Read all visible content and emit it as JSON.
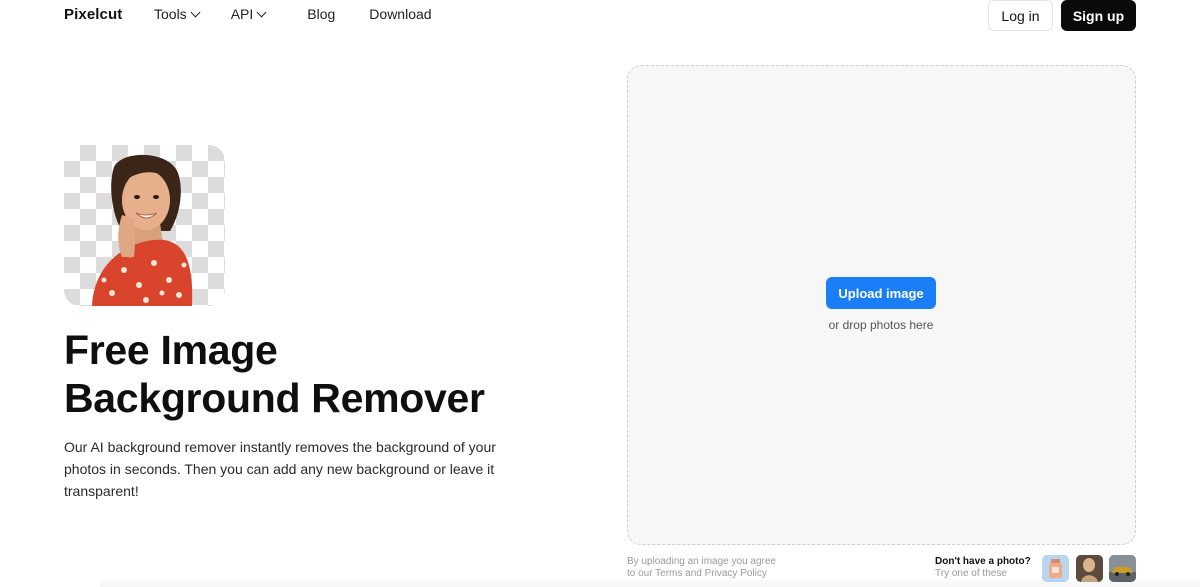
{
  "nav": {
    "logo": "Pixelcut",
    "links": [
      {
        "label": "Tools",
        "has_dropdown": true
      },
      {
        "label": "API",
        "has_dropdown": true
      },
      {
        "label": "Blog",
        "has_dropdown": false
      },
      {
        "label": "Download",
        "has_dropdown": false
      }
    ],
    "login_label": "Log in",
    "signup_label": "Sign up"
  },
  "hero": {
    "title_line1": "Free Image",
    "title_line2": "Background Remover",
    "description": "Our AI background remover instantly removes the background of your photos in seconds. Then you can add any new background or leave it transparent!",
    "image_icon": "person-cutout-image"
  },
  "upload": {
    "button_label": "Upload image",
    "drop_hint": "or drop photos here",
    "terms_line1": "By uploading an image you agree",
    "terms_line2": "to our Terms and Privacy Policy",
    "no_photo_question": "Don't have a photo?",
    "try_samples": "Try one of these"
  },
  "colors": {
    "accent": "#1a7ff7",
    "signup_bg": "#0a0a0a",
    "dropzone_bg": "#f7f7f7"
  }
}
